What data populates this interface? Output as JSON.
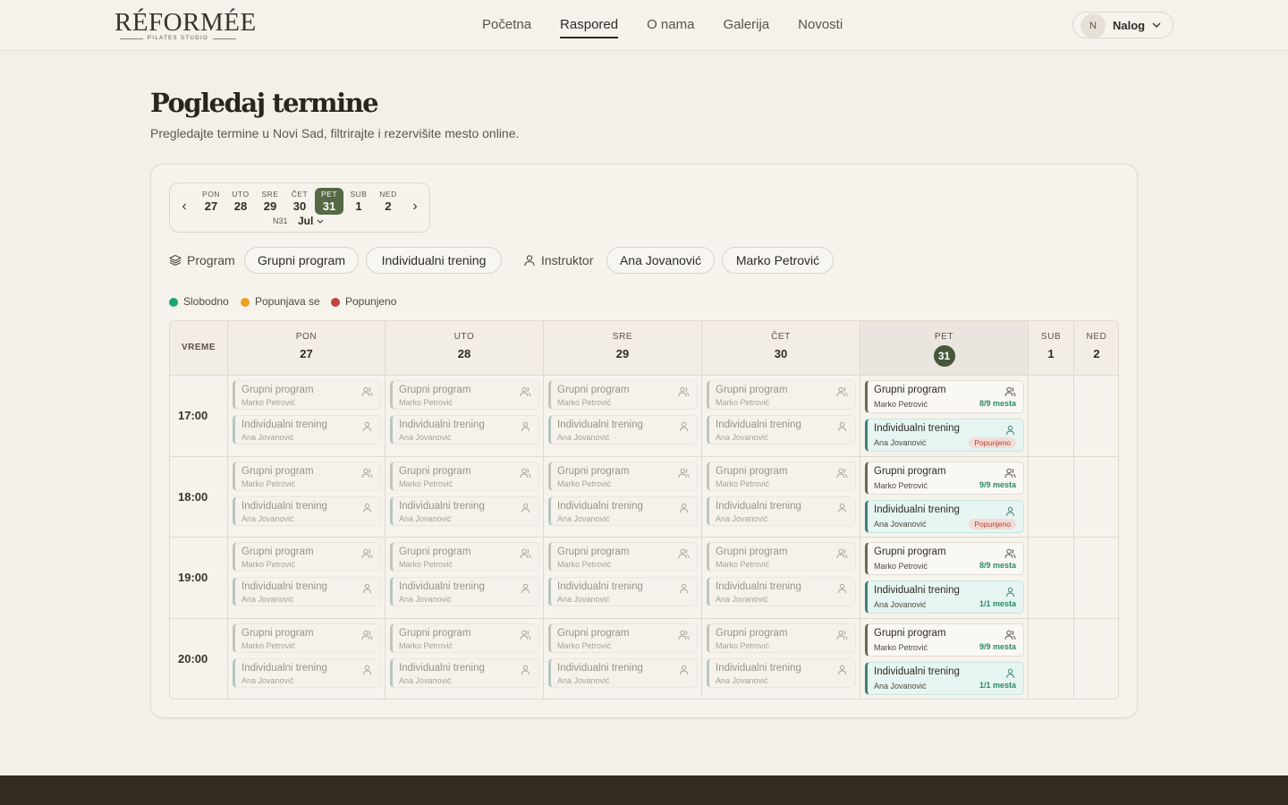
{
  "header": {
    "logo_text": "RÉFORMÉE",
    "logo_sub": "PILATES STUDIO",
    "nav": [
      "Početna",
      "Raspored",
      "O nama",
      "Galerija",
      "Novosti"
    ],
    "account_initial": "N",
    "account_label": "Nalog"
  },
  "page": {
    "title": "Pogledaj termine",
    "subtitle": "Pregledajte termine u Novi Sad, filtrirajte i rezervišite mesto online."
  },
  "datestrip": {
    "days": [
      {
        "name": "PON",
        "date": "27"
      },
      {
        "name": "UTO",
        "date": "28"
      },
      {
        "name": "SRE",
        "date": "29"
      },
      {
        "name": "ČET",
        "date": "30"
      },
      {
        "name": "PET",
        "date": "31"
      },
      {
        "name": "SUB",
        "date": "1"
      },
      {
        "name": "NED",
        "date": "2"
      }
    ],
    "selected_index": 4,
    "week": "N31",
    "month": "Jul"
  },
  "filters": {
    "program_label": "Program",
    "programs": [
      "Grupni program",
      "Individualni trening"
    ],
    "instructor_label": "Instruktor",
    "instructors": [
      "Ana Jovanović",
      "Marko Petrović"
    ]
  },
  "legend": [
    {
      "label": "Slobodno",
      "color": "#1ea672"
    },
    {
      "label": "Popunjava se",
      "color": "#f0a020"
    },
    {
      "label": "Popunjeno",
      "color": "#c0453a"
    }
  ],
  "grid": {
    "time_header": "VREME",
    "columns": [
      {
        "name": "PON",
        "date": "27"
      },
      {
        "name": "UTO",
        "date": "28"
      },
      {
        "name": "SRE",
        "date": "29"
      },
      {
        "name": "ČET",
        "date": "30"
      },
      {
        "name": "PET",
        "date": "31"
      },
      {
        "name": "SUB",
        "date": "1"
      },
      {
        "name": "NED",
        "date": "2"
      }
    ],
    "times": [
      "17:00",
      "18:00",
      "19:00",
      "20:00"
    ],
    "slot_group_title": "Grupni program",
    "slot_group_instructor": "Marko Petrović",
    "slot_ind_title": "Individualni trening",
    "slot_ind_instructor": "Ana Jovanović",
    "active": [
      {
        "group_status": "8/9 mesta",
        "ind_status": "Popunjeno",
        "ind_full": true
      },
      {
        "group_status": "9/9 mesta",
        "ind_status": "Popunjeno",
        "ind_full": true
      },
      {
        "group_status": "8/9 mesta",
        "ind_status": "1/1 mesta",
        "ind_full": false
      },
      {
        "group_status": "9/9 mesta",
        "ind_status": "1/1 mesta",
        "ind_full": false
      }
    ]
  },
  "colors": {
    "accent": "#556944",
    "selected_circle": "#46563a",
    "available": "#2a8a62",
    "full_text": "#b0443a",
    "full_bg": "#f4dcd6",
    "footer": "#332a21"
  }
}
